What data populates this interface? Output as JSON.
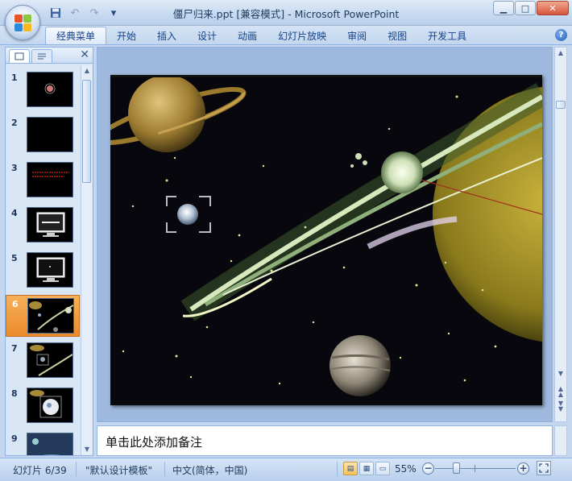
{
  "window": {
    "title": "僵尸归来.ppt [兼容模式] - Microsoft PowerPoint"
  },
  "quick_access": {
    "icons": [
      "save-icon",
      "undo-icon",
      "redo-icon",
      "customize-icon"
    ]
  },
  "ribbon": {
    "tabs": [
      {
        "label": "经典菜单",
        "active": true
      },
      {
        "label": "开始"
      },
      {
        "label": "插入"
      },
      {
        "label": "设计"
      },
      {
        "label": "动画"
      },
      {
        "label": "幻灯片放映"
      },
      {
        "label": "审阅"
      },
      {
        "label": "视图"
      },
      {
        "label": "开发工具"
      }
    ],
    "help_label": "?"
  },
  "slide_panel": {
    "close_label": "✕",
    "slides": [
      {
        "number": "1"
      },
      {
        "number": "2"
      },
      {
        "number": "3"
      },
      {
        "number": "4"
      },
      {
        "number": "5"
      },
      {
        "number": "6",
        "selected": true
      },
      {
        "number": "7"
      },
      {
        "number": "8"
      },
      {
        "number": "9"
      }
    ]
  },
  "notes": {
    "placeholder": "单击此处添加备注"
  },
  "status": {
    "slide_info": "幻灯片 6/39",
    "theme": "\"默认设计模板\"",
    "language": "中文(简体，中国)",
    "zoom": "55%",
    "zoom_out_label": "−",
    "zoom_in_label": "+"
  },
  "colors": {
    "accent": "#f5a64a",
    "ribbon_text": "#15428b",
    "frame": "#c4d7ee"
  }
}
